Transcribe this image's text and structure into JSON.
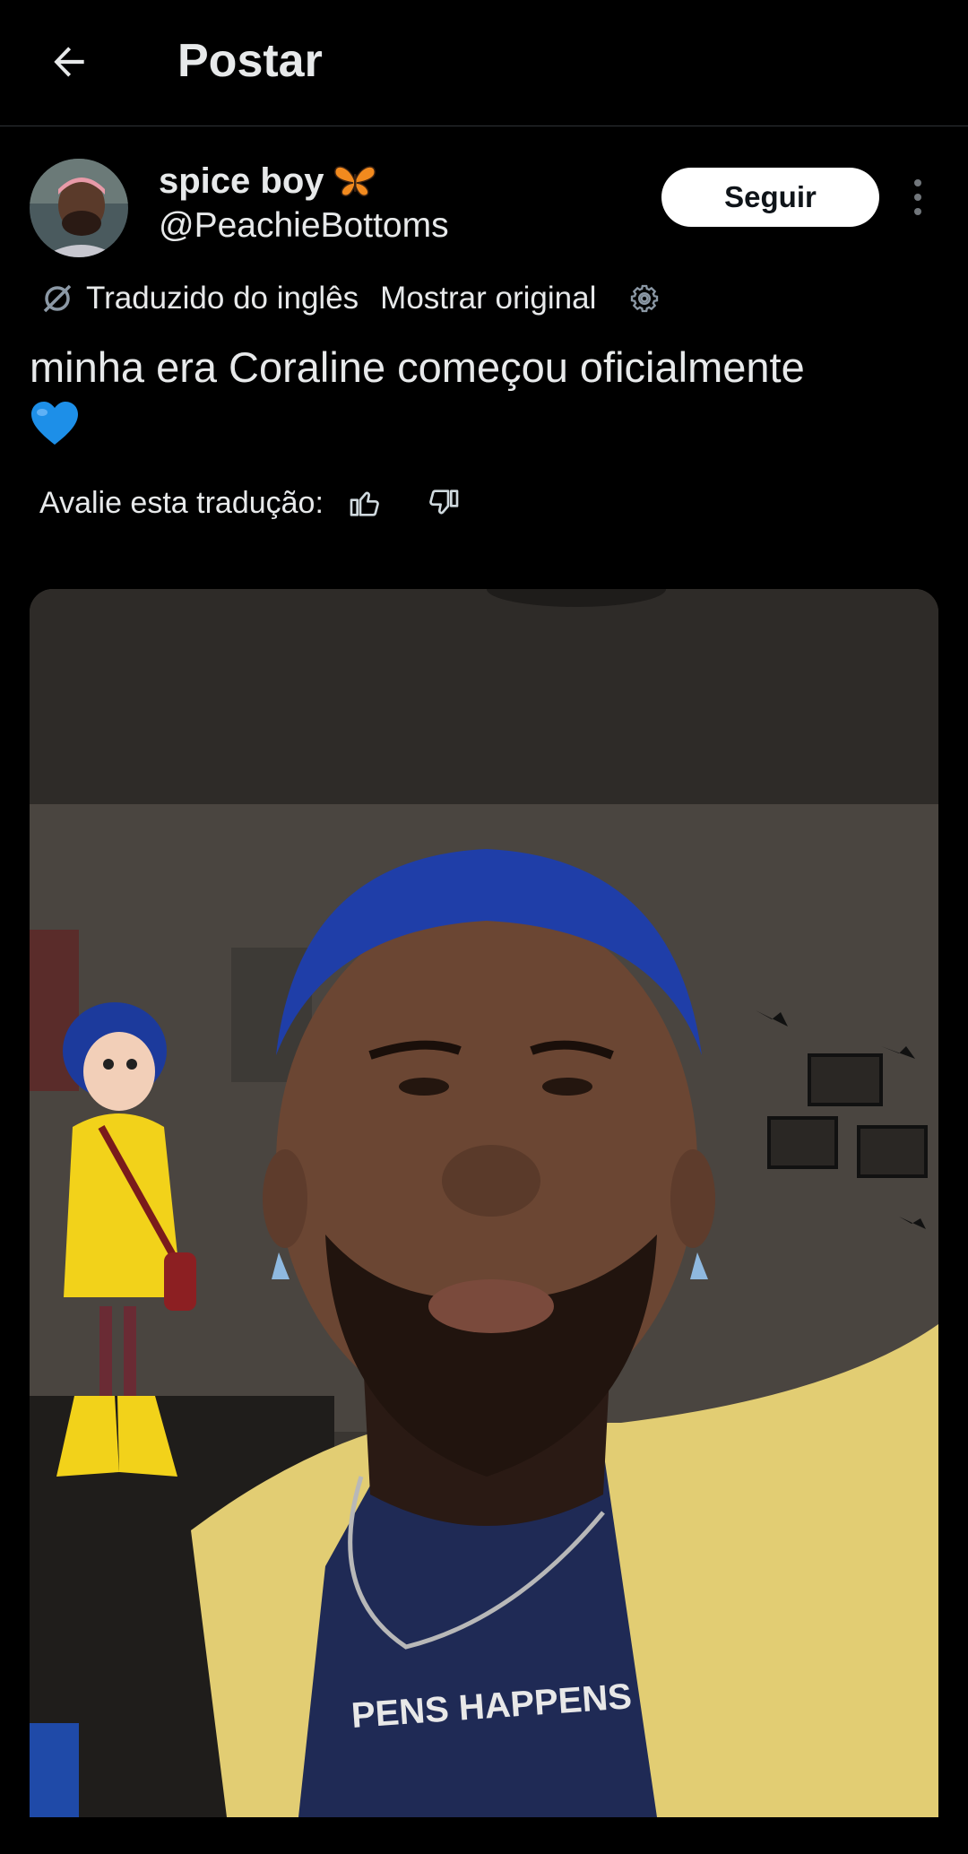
{
  "header": {
    "title": "Postar",
    "back_icon": "arrow-left-icon"
  },
  "author": {
    "name": "spice boy",
    "name_emoji": "butterfly-icon",
    "handle": "@PeachieBottoms",
    "follow_label": "Seguir",
    "more_icon": "more-vertical-icon"
  },
  "translation": {
    "translated_from": "Traduzido do inglês",
    "show_original": "Mostrar original",
    "settings_icon": "gear-icon"
  },
  "tweet": {
    "text": "minha era Coraline começou oficialmente",
    "emoji": "blue-heart-icon"
  },
  "rating": {
    "label": "Avalie esta tradução:",
    "up_icon": "thumbs-up-icon",
    "down_icon": "thumbs-down-icon"
  },
  "media": {
    "type": "photo"
  },
  "colors": {
    "background": "#000000",
    "text": "#e7e9ea",
    "divider": "#2f3336",
    "follow_bg": "#ffffff",
    "follow_text": "#0f1419",
    "heart": "#1d8fe8"
  }
}
